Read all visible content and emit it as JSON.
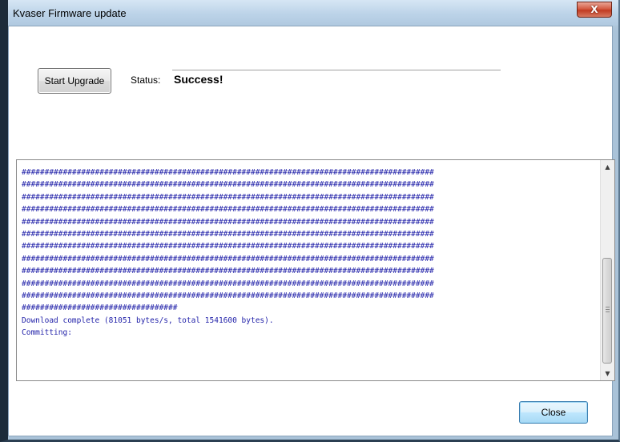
{
  "window": {
    "title": "Kvaser Firmware update",
    "close_glyph": "X"
  },
  "controls": {
    "start_button_label": "Start Upgrade",
    "status_label": "Status:",
    "status_value": "Success!"
  },
  "log": {
    "lines": [
      "##########################################################################################",
      "##########################################################################################",
      "##########################################################################################",
      "##########################################################################################",
      "##########################################################################################",
      "##########################################################################################",
      "##########################################################################################",
      "##########################################################################################",
      "##########################################################################################",
      "##########################################################################################",
      "##########################################################################################",
      "##################################",
      "Download complete (81051 bytes/s, total 1541600 bytes).",
      "Committing:"
    ],
    "text_color": "#1f1fa8"
  },
  "scrollbar": {
    "up_glyph": "▲",
    "down_glyph": "▼"
  },
  "footer": {
    "close_button_label": "Close"
  },
  "colors": {
    "title_close_red": "#c13b22",
    "default_button_border": "#3c7fb1"
  }
}
